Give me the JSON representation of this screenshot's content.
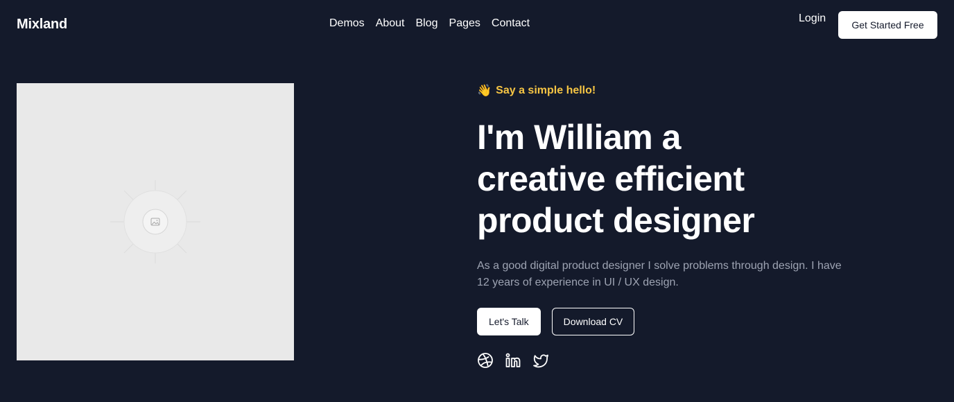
{
  "header": {
    "brand": "Mixland",
    "nav": [
      "Demos",
      "About",
      "Blog",
      "Pages",
      "Contact"
    ],
    "login_label": "Login",
    "cta_label": "Get Started Free"
  },
  "hero": {
    "eyebrow_emoji": "👋",
    "eyebrow_text": "Say a simple hello!",
    "headline_lines": [
      "I'm William a",
      "creative efficient",
      "product designer"
    ],
    "description": "As a good digital product designer I solve problems through design. I have 12 years of experience in UI / UX design.",
    "primary_button": "Let's Talk",
    "secondary_button": "Download CV",
    "image_icon": "image-placeholder-icon",
    "socials": [
      "dribbble-icon",
      "linkedin-icon",
      "twitter-icon"
    ]
  },
  "colors": {
    "background": "#141a2b",
    "accent": "#f6c544",
    "text": "#ffffff",
    "muted": "#9ea4b3",
    "placeholder_bg": "#e9e9e9"
  }
}
